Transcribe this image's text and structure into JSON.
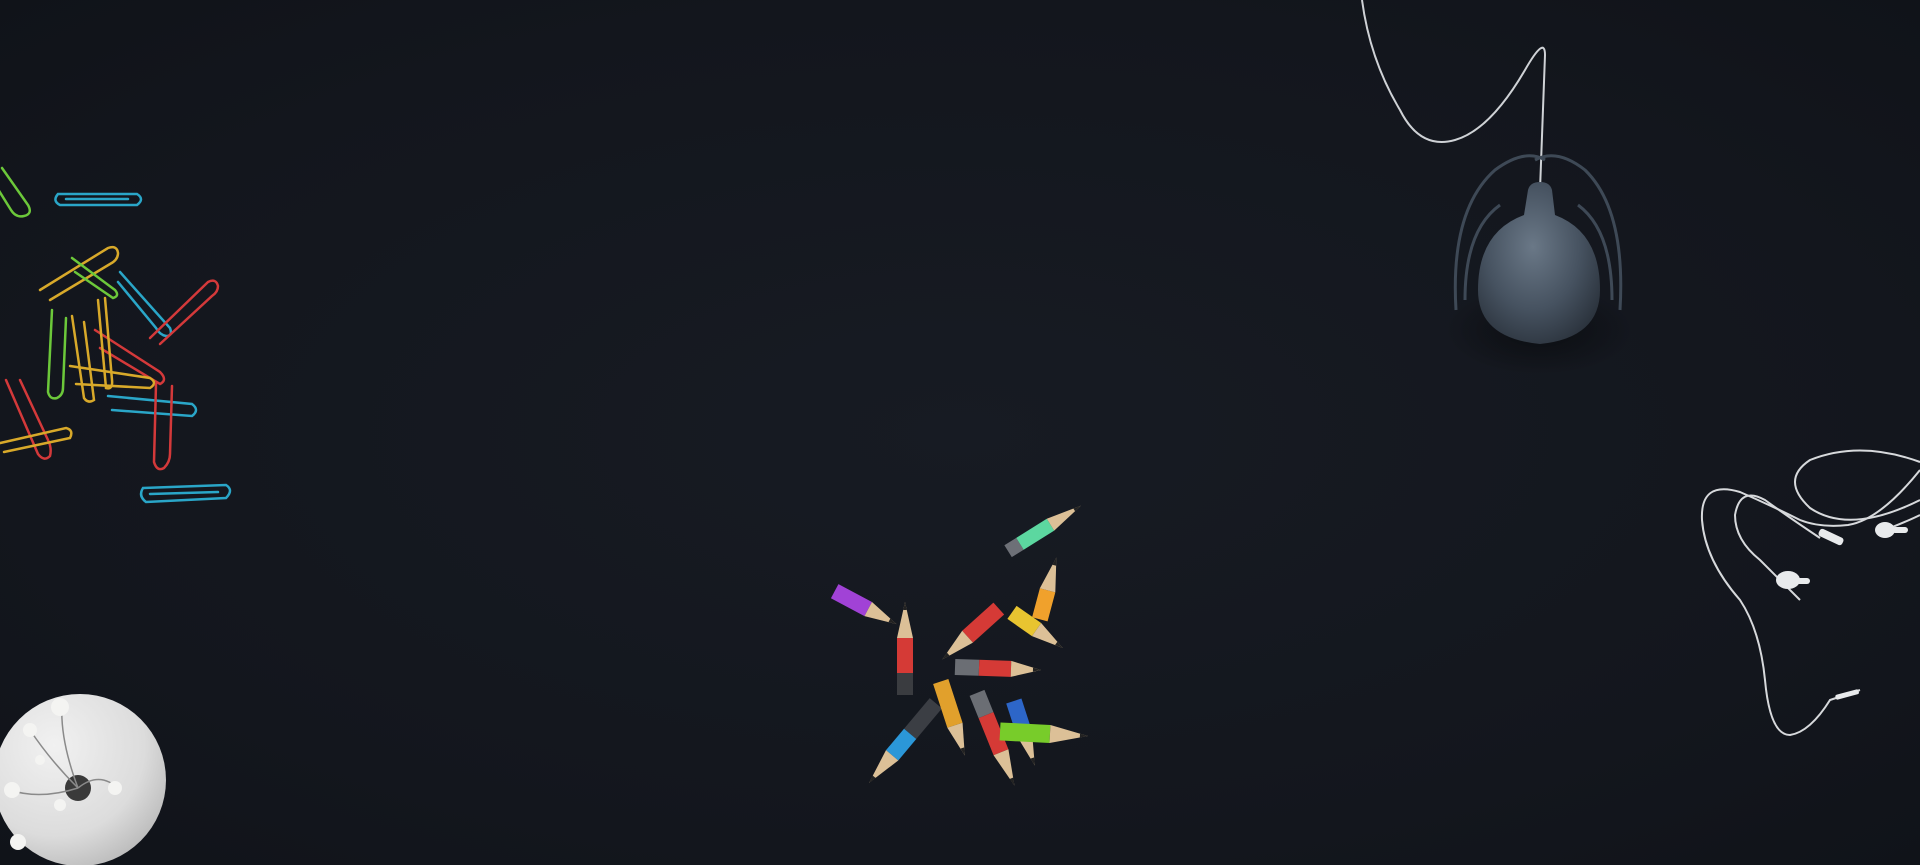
{
  "scene": {
    "background_color": "#141820",
    "objects": [
      "paperclips",
      "lamp",
      "earphones",
      "pencils",
      "flower-vase"
    ]
  },
  "colors": {
    "clip_green": "#6cc83a",
    "clip_cyan": "#2aa6c8",
    "clip_yellow": "#d8a92a",
    "clip_red": "#d4393a",
    "lamp_body": "#4a5663",
    "cable_white": "#d7d9dc",
    "vase_white": "#e6e6e6"
  }
}
